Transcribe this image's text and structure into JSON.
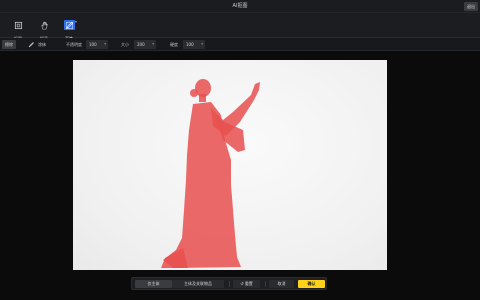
{
  "window": {
    "title": "AI抠图",
    "close_label": "退出"
  },
  "toolbar": {
    "tools": [
      {
        "label": "抠图",
        "icon": "crop-icon"
      },
      {
        "label": "抓手",
        "icon": "hand-icon"
      },
      {
        "label": "画笔",
        "icon": "brush-icon"
      }
    ]
  },
  "options": {
    "mode_keep": "擦除",
    "mode_add": "涂抹",
    "opacity_label": "不透明度",
    "opacity_value": "100",
    "size_label": "大小",
    "size_value": "200",
    "hardness_label": "硬度",
    "hardness_value": "100"
  },
  "actions": {
    "subject": "仅主体",
    "subject_and_items": "主体及关联物品",
    "reset": "重置",
    "cancel": "取消",
    "confirm": "确认"
  },
  "colors": {
    "accent": "#2e6ff2",
    "mask": "#e8504f",
    "confirm": "#ffd11a"
  }
}
